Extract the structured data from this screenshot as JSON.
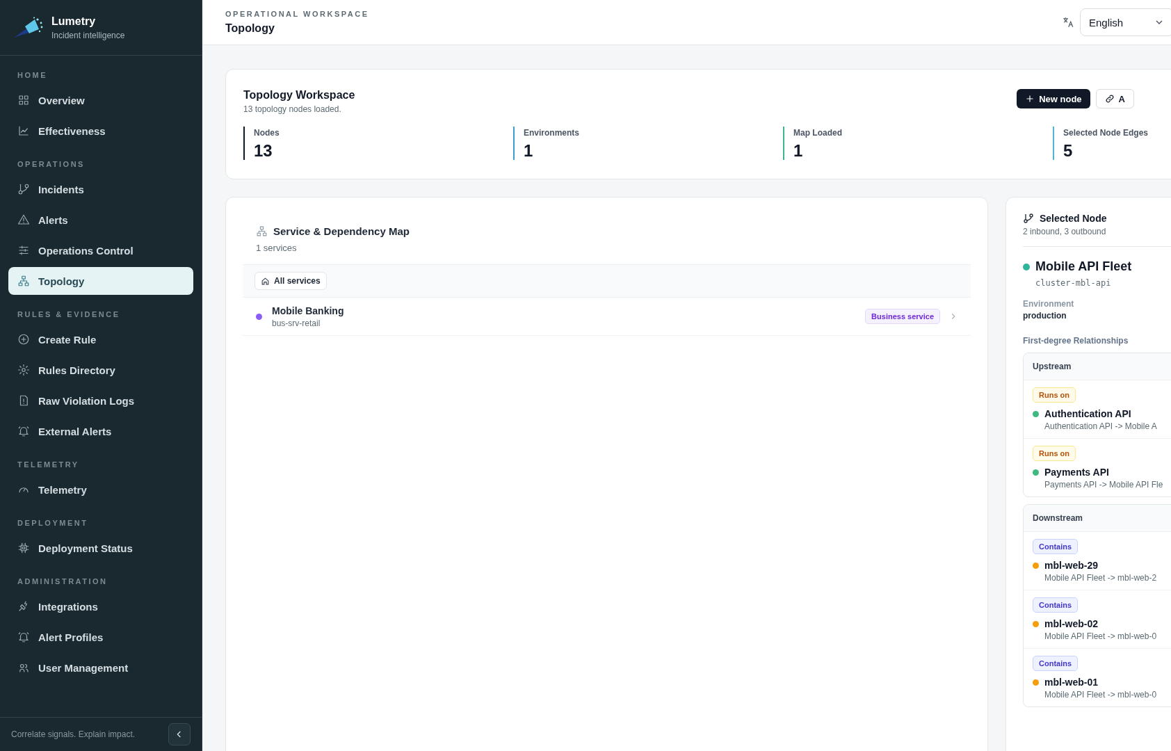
{
  "brand": {
    "name": "Lumetry",
    "tagline": "Incident intelligence"
  },
  "sidebar": {
    "sections": [
      {
        "label": "HOME",
        "items": [
          {
            "label": "Overview",
            "selected": false
          },
          {
            "label": "Effectiveness",
            "selected": false
          }
        ]
      },
      {
        "label": "OPERATIONS",
        "items": [
          {
            "label": "Incidents",
            "selected": false
          },
          {
            "label": "Alerts",
            "selected": false
          },
          {
            "label": "Operations Control",
            "selected": false
          },
          {
            "label": "Topology",
            "selected": true
          }
        ]
      },
      {
        "label": "RULES & EVIDENCE",
        "items": [
          {
            "label": "Create Rule",
            "selected": false
          },
          {
            "label": "Rules Directory",
            "selected": false
          },
          {
            "label": "Raw Violation Logs",
            "selected": false
          },
          {
            "label": "External Alerts",
            "selected": false
          }
        ]
      },
      {
        "label": "TELEMETRY",
        "items": [
          {
            "label": "Telemetry",
            "selected": false
          }
        ]
      },
      {
        "label": "DEPLOYMENT",
        "items": [
          {
            "label": "Deployment Status",
            "selected": false
          }
        ]
      },
      {
        "label": "ADMINISTRATION",
        "items": [
          {
            "label": "Integrations",
            "selected": false
          },
          {
            "label": "Alert Profiles",
            "selected": false
          },
          {
            "label": "User Management",
            "selected": false
          }
        ]
      }
    ],
    "footer": "Correlate signals. Explain impact."
  },
  "header": {
    "eyebrow": "OPERATIONAL WORKSPACE",
    "title": "Topology",
    "language": "English"
  },
  "workspace": {
    "title": "Topology Workspace",
    "subtitle": "13 topology nodes loaded.",
    "buttons": [
      {
        "label": "New node",
        "kind": "primary"
      },
      {
        "label": "A",
        "kind": "link"
      }
    ],
    "stats": [
      {
        "label": "Nodes",
        "value": "13",
        "color": "#111827"
      },
      {
        "label": "Environments",
        "value": "1",
        "color": "#3b9fd1"
      },
      {
        "label": "Map Loaded",
        "value": "1",
        "color": "#3bb88a"
      },
      {
        "label": "Selected Node Edges",
        "value": "5",
        "color": "#4bb8cf"
      }
    ]
  },
  "map": {
    "title": "Service & Dependency Map",
    "subtitle": "1 services",
    "breadcrumb": "All services",
    "services": [
      {
        "name": "Mobile Banking",
        "id": "bus-srv-retail",
        "badge": "Business service",
        "color": "#8b5cf6"
      }
    ]
  },
  "selected_node": {
    "title": "Selected Node",
    "subtitle": "2 inbound, 3 outbound",
    "node": {
      "name": "Mobile API Fleet",
      "id": "cluster-mbl-api",
      "color": "#2fb59c"
    },
    "environment_label": "Environment",
    "environment": "production",
    "relationships_label": "First-degree Relationships",
    "groups": [
      {
        "title": "Upstream",
        "items": [
          {
            "relation": "Runs on",
            "kind": "runs_on",
            "name": "Authentication API",
            "path": "Authentication API -> Mobile A",
            "color": "#3dbb7f"
          },
          {
            "relation": "Runs on",
            "kind": "runs_on",
            "name": "Payments API",
            "path": "Payments API -> Mobile API Fle",
            "color": "#3dbb7f"
          }
        ]
      },
      {
        "title": "Downstream",
        "items": [
          {
            "relation": "Contains",
            "kind": "contains",
            "name": "mbl-web-29",
            "path": "Mobile API Fleet -> mbl-web-2",
            "color": "#f59e0b"
          },
          {
            "relation": "Contains",
            "kind": "contains",
            "name": "mbl-web-02",
            "path": "Mobile API Fleet -> mbl-web-0",
            "color": "#f59e0b"
          },
          {
            "relation": "Contains",
            "kind": "contains",
            "name": "mbl-web-01",
            "path": "Mobile API Fleet -> mbl-web-0",
            "color": "#f59e0b"
          }
        ]
      }
    ]
  }
}
